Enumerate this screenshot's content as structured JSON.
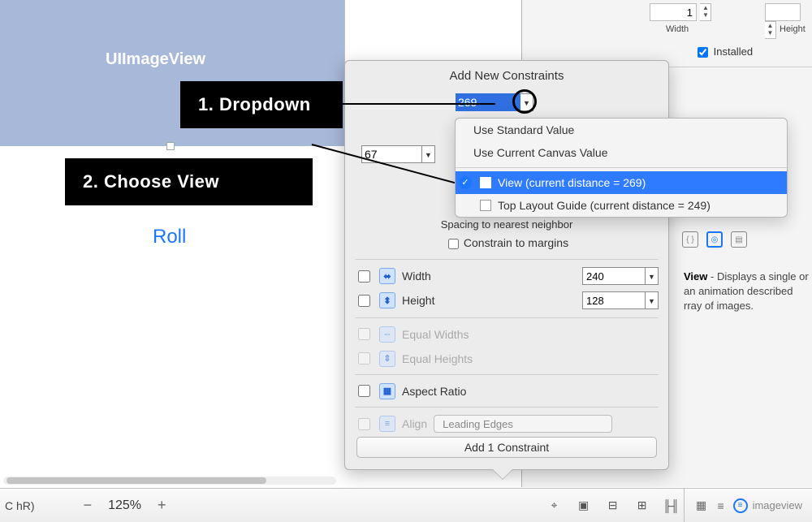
{
  "canvas": {
    "view_label": "UIImageView",
    "button_label": "Roll"
  },
  "annotations": {
    "step1": "1. Dropdown",
    "step2": "2. Choose View"
  },
  "inspector": {
    "width_value": "1",
    "width_label": "Width",
    "height_label": "Height",
    "installed_label": "Installed",
    "help_text_bold": "View",
    "help_text_rest": " - Displays a single or an animation described rray of images."
  },
  "popover": {
    "title": "Add New Constraints",
    "top_value": "269",
    "left_value": "67",
    "right_value": "",
    "spacing_label": "Spacing to nearest neighbor",
    "constrain_margins_label": "Constrain to margins",
    "width_label": "Width",
    "width_value": "240",
    "height_label": "Height",
    "height_value": "128",
    "equal_widths_label": "Equal Widths",
    "equal_heights_label": "Equal Heights",
    "aspect_ratio_label": "Aspect Ratio",
    "align_label": "Align",
    "align_value": "Leading Edges",
    "add_button": "Add 1 Constraint"
  },
  "dropdown": {
    "use_standard": "Use Standard Value",
    "use_current_canvas": "Use Current Canvas Value",
    "view_option": "View (current distance = 269)",
    "top_layout_option": "Top Layout Guide (current distance = 249)"
  },
  "bottom": {
    "size_class": "C  hR)",
    "zoom": "125%",
    "filter_text": "imageview"
  }
}
